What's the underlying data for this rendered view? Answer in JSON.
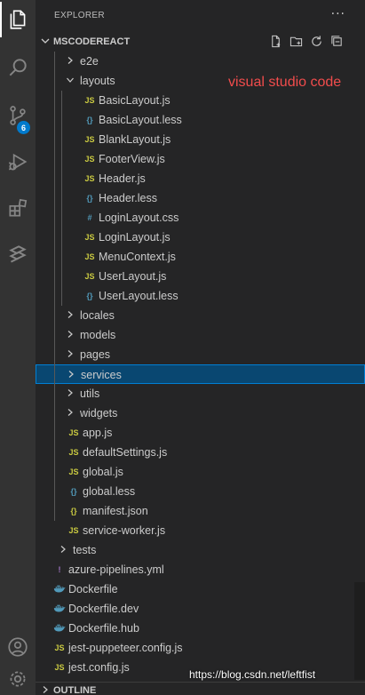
{
  "sidebar": {
    "title": "EXPLORER",
    "more": "···",
    "project_title": "MSCODEREACT",
    "outline_title": "OUTLINE"
  },
  "activity": {
    "badge": "6",
    "items": [
      "explorer",
      "search",
      "source-control",
      "run-debug",
      "extensions",
      "remote"
    ]
  },
  "annotation": "visual studio code",
  "watermark": "https://blog.csdn.net/leftfist",
  "tree": {
    "items": [
      {
        "label": "e2e",
        "type": "folder",
        "expanded": false
      },
      {
        "label": "layouts",
        "type": "folder",
        "expanded": true
      },
      {
        "label": "BasicLayout.js",
        "type": "js",
        "icon": "JS"
      },
      {
        "label": "BasicLayout.less",
        "type": "less",
        "icon": "{}"
      },
      {
        "label": "BlankLayout.js",
        "type": "js",
        "icon": "JS"
      },
      {
        "label": "FooterView.js",
        "type": "js",
        "icon": "JS"
      },
      {
        "label": "Header.js",
        "type": "js",
        "icon": "JS"
      },
      {
        "label": "Header.less",
        "type": "less",
        "icon": "{}"
      },
      {
        "label": "LoginLayout.css",
        "type": "css",
        "icon": "#"
      },
      {
        "label": "LoginLayout.js",
        "type": "js",
        "icon": "JS"
      },
      {
        "label": "MenuContext.js",
        "type": "js",
        "icon": "JS"
      },
      {
        "label": "UserLayout.js",
        "type": "js",
        "icon": "JS"
      },
      {
        "label": "UserLayout.less",
        "type": "less",
        "icon": "{}"
      },
      {
        "label": "locales",
        "type": "folder",
        "expanded": false
      },
      {
        "label": "models",
        "type": "folder",
        "expanded": false
      },
      {
        "label": "pages",
        "type": "folder",
        "expanded": false
      },
      {
        "label": "services",
        "type": "folder",
        "expanded": false,
        "selected": true
      },
      {
        "label": "utils",
        "type": "folder",
        "expanded": false
      },
      {
        "label": "widgets",
        "type": "folder",
        "expanded": false
      },
      {
        "label": "app.js",
        "type": "js",
        "icon": "JS"
      },
      {
        "label": "defaultSettings.js",
        "type": "js",
        "icon": "JS"
      },
      {
        "label": "global.js",
        "type": "js",
        "icon": "JS"
      },
      {
        "label": "global.less",
        "type": "less",
        "icon": "{}"
      },
      {
        "label": "manifest.json",
        "type": "json",
        "icon": "{}"
      },
      {
        "label": "service-worker.js",
        "type": "js",
        "icon": "JS"
      },
      {
        "label": "tests",
        "type": "folder",
        "expanded": false
      },
      {
        "label": "azure-pipelines.yml",
        "type": "yml",
        "icon": "!"
      },
      {
        "label": "Dockerfile",
        "type": "docker"
      },
      {
        "label": "Dockerfile.dev",
        "type": "docker"
      },
      {
        "label": "Dockerfile.hub",
        "type": "docker"
      },
      {
        "label": "jest-puppeteer.config.js",
        "type": "js",
        "icon": "JS"
      },
      {
        "label": "jest.config.js",
        "type": "js",
        "icon": "JS"
      }
    ]
  },
  "colors": {
    "activity_bar": "#333333",
    "sidebar": "#252526",
    "selection": "#094771",
    "selection_border": "#007fd4",
    "badge": "#007acc",
    "annotation": "#f14c4c",
    "js": "#cbcb41",
    "less": "#519aba",
    "docker": "#519aba",
    "yml": "#a074c4"
  }
}
